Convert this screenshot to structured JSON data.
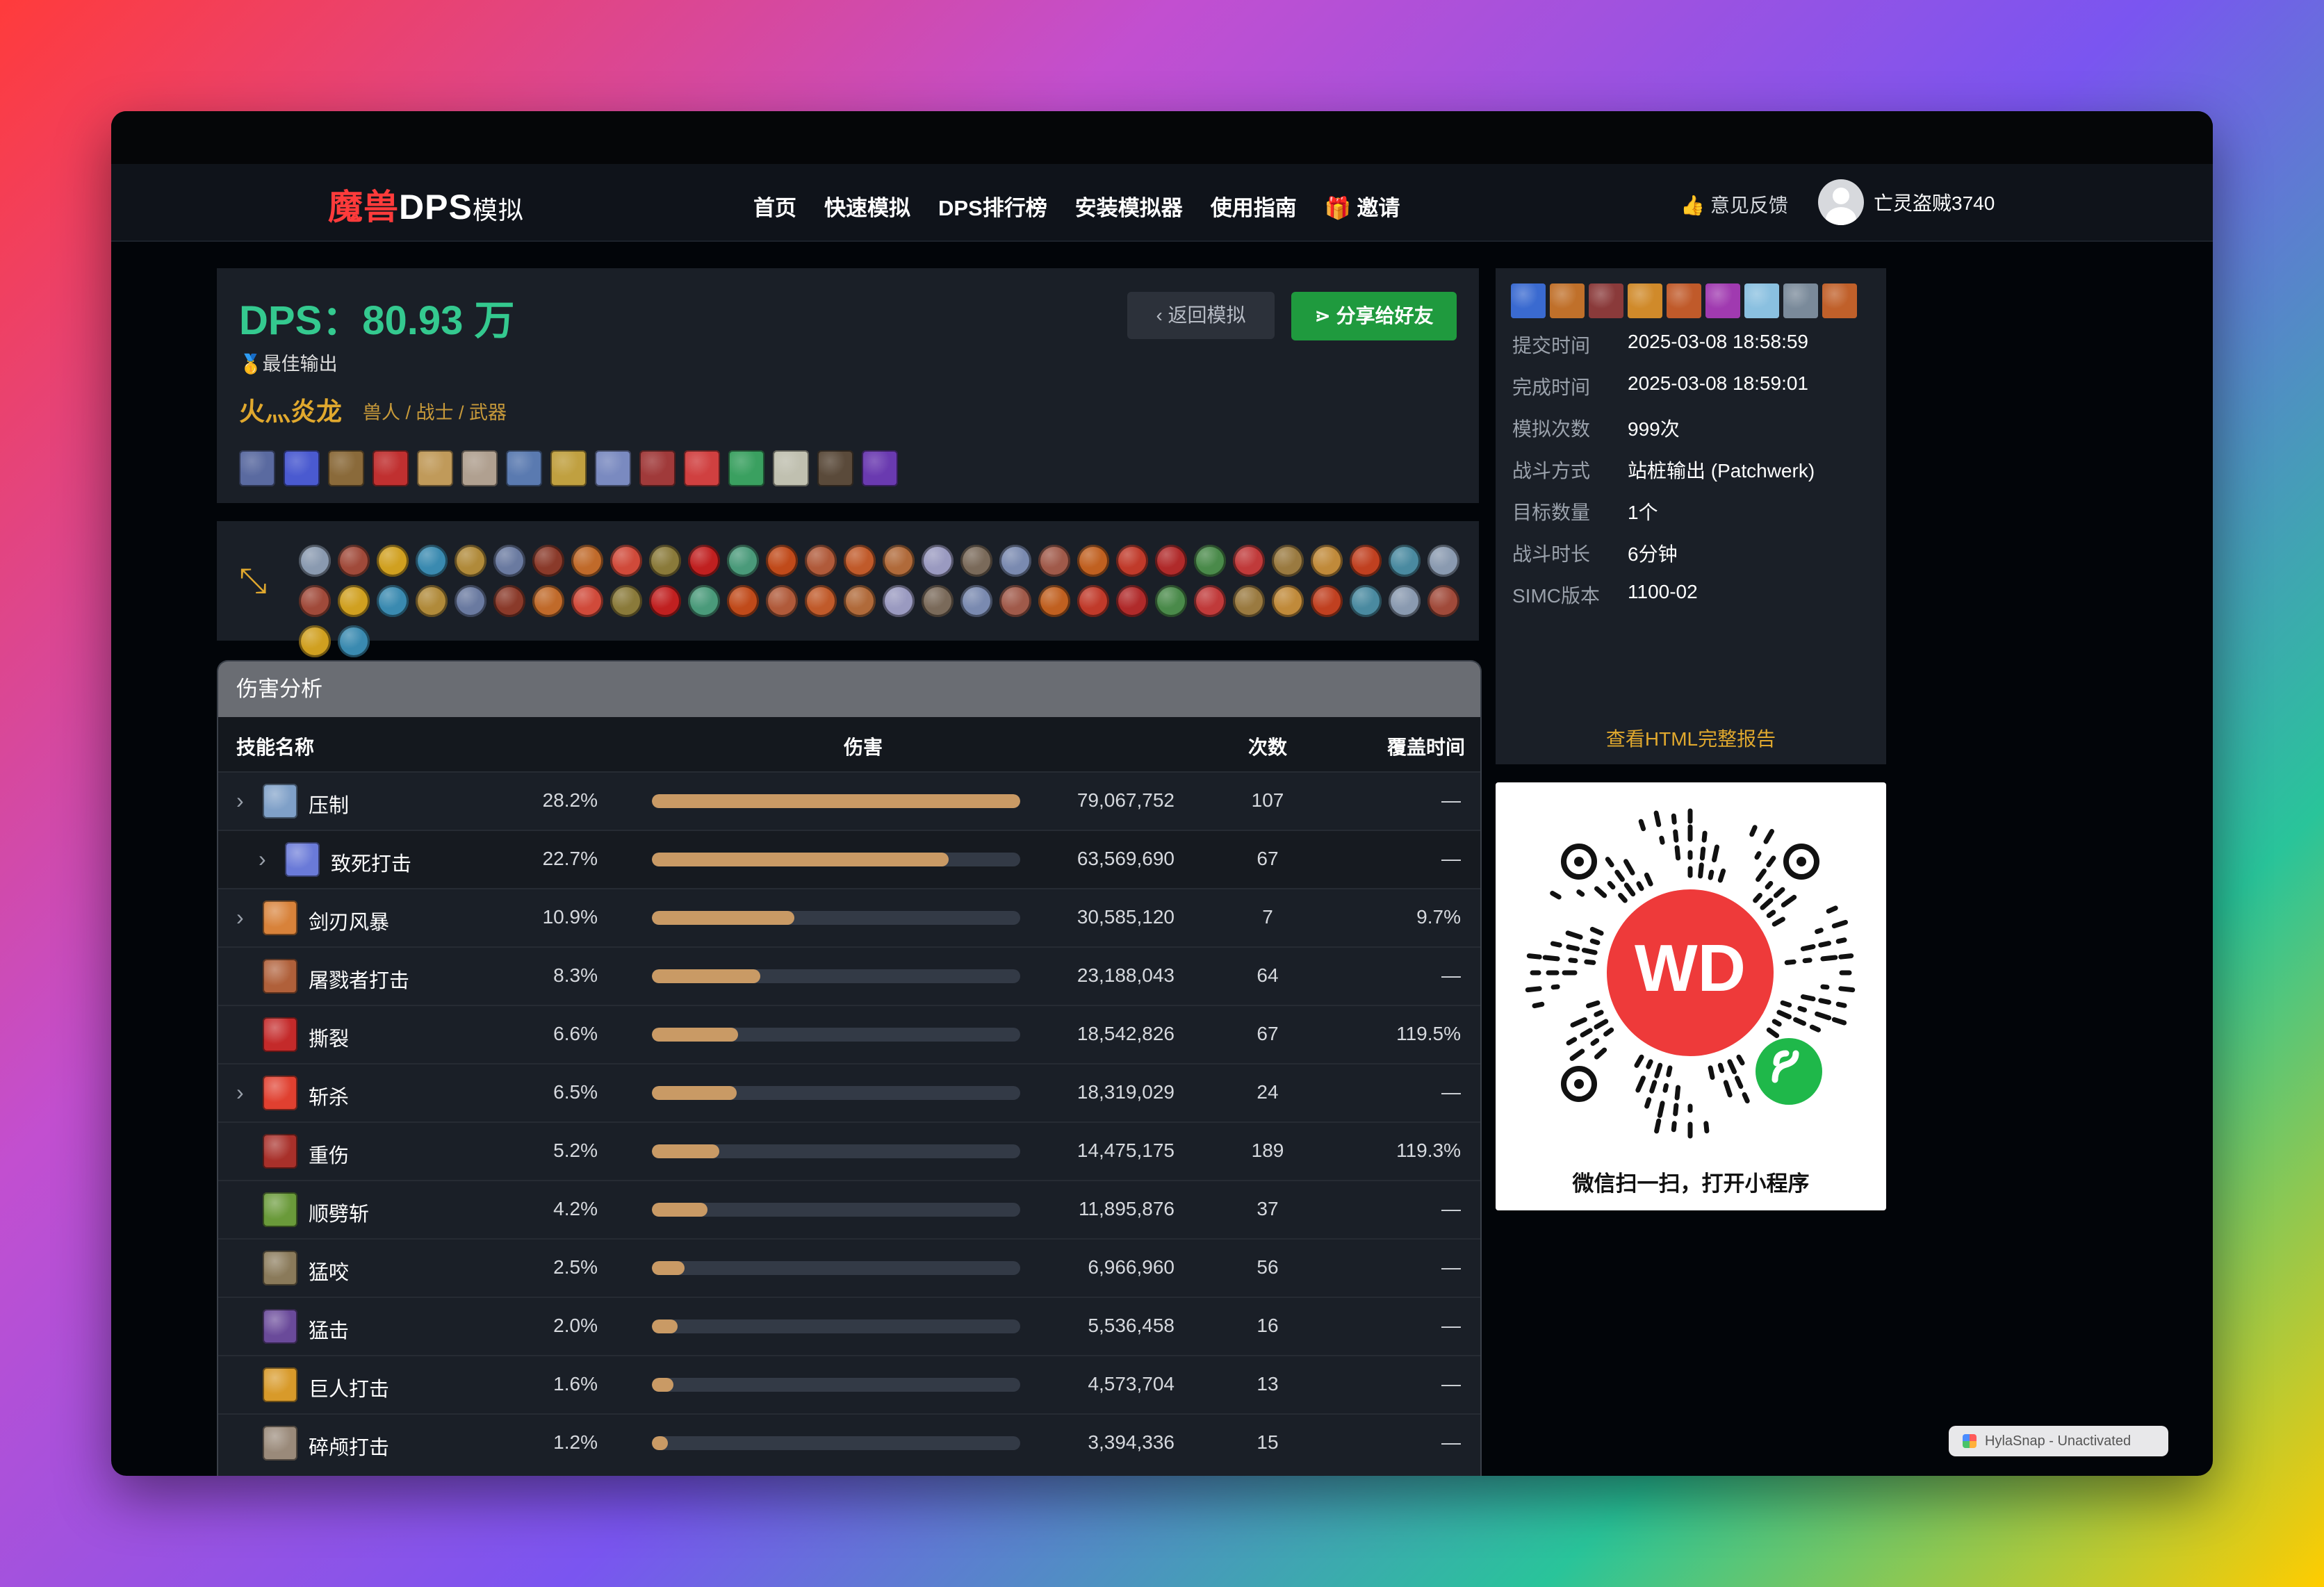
{
  "navbar": {
    "logo_red": "魔兽",
    "logo_white": "DPS",
    "logo_small": "模拟",
    "items": [
      {
        "label": "首页"
      },
      {
        "label": "快速模拟"
      },
      {
        "label": "DPS排行榜"
      },
      {
        "label": "安装模拟器"
      },
      {
        "label": "使用指南"
      },
      {
        "label": "邀请",
        "icon": "gift-icon"
      }
    ],
    "feedback": "意见反馈",
    "username": "亡灵盗贼3740"
  },
  "hero": {
    "dps": "DPS：80.93 万",
    "badge": "🥇最佳输出",
    "character_name": "火灬炎龙",
    "character_meta": "兽人 / 战士 / 武器",
    "back_button": "返回模拟",
    "share_button": "分享给好友",
    "gear_slots": 15
  },
  "talents": {
    "count": 62
  },
  "sim_info": [
    {
      "key": "提交时间",
      "value": "2025-03-08 18:58:59"
    },
    {
      "key": "完成时间",
      "value": "2025-03-08 18:59:01"
    },
    {
      "key": "模拟次数",
      "value": "999次"
    },
    {
      "key": "战斗方式",
      "value": "站桩输出 (Patchwerk)"
    },
    {
      "key": "目标数量",
      "value": "1个"
    },
    {
      "key": "战斗时长",
      "value": "6分钟"
    },
    {
      "key": "SIMC版本",
      "value": "1100-02"
    }
  ],
  "html_report_link": "查看HTML完整报告",
  "qr": {
    "logo_text": "WD",
    "caption": "微信扫一扫，打开小程序"
  },
  "damage": {
    "title": "伤害分析",
    "columns": {
      "name": "技能名称",
      "damage": "伤害",
      "count": "次数",
      "coverage": "覆盖时间"
    },
    "rows": [
      {
        "name": "压制",
        "pct": "28.2%",
        "share": 1.0,
        "damage": "79,067,752",
        "count": "107",
        "coverage": "—",
        "expandable": true,
        "sub": false,
        "color": "#7fa0c8"
      },
      {
        "name": "致死打击",
        "pct": "22.7%",
        "share": 0.805,
        "damage": "63,569,690",
        "count": "67",
        "coverage": "—",
        "expandable": true,
        "sub": true,
        "color": "#6a7ad8"
      },
      {
        "name": "剑刃风暴",
        "pct": "10.9%",
        "share": 0.387,
        "damage": "30,585,120",
        "count": "7",
        "coverage": "9.7%",
        "expandable": true,
        "sub": false,
        "color": "#d8823a"
      },
      {
        "name": "屠戮者打击",
        "pct": "8.3%",
        "share": 0.294,
        "damage": "23,188,043",
        "count": "64",
        "coverage": "—",
        "expandable": false,
        "sub": false,
        "color": "#b0603a"
      },
      {
        "name": "撕裂",
        "pct": "6.6%",
        "share": 0.234,
        "damage": "18,542,826",
        "count": "67",
        "coverage": "119.5%",
        "expandable": false,
        "sub": false,
        "color": "#c42a2a"
      },
      {
        "name": "斩杀",
        "pct": "6.5%",
        "share": 0.231,
        "damage": "18,319,029",
        "count": "24",
        "coverage": "—",
        "expandable": true,
        "sub": false,
        "color": "#e04030"
      },
      {
        "name": "重伤",
        "pct": "5.2%",
        "share": 0.183,
        "damage": "14,475,175",
        "count": "189",
        "coverage": "119.3%",
        "expandable": false,
        "sub": false,
        "color": "#a8302a"
      },
      {
        "name": "顺劈斩",
        "pct": "4.2%",
        "share": 0.15,
        "damage": "11,895,876",
        "count": "37",
        "coverage": "—",
        "expandable": false,
        "sub": false,
        "color": "#6a9a3a"
      },
      {
        "name": "猛咬",
        "pct": "2.5%",
        "share": 0.088,
        "damage": "6,966,960",
        "count": "56",
        "coverage": "—",
        "expandable": false,
        "sub": false,
        "color": "#8a7a5a"
      },
      {
        "name": "猛击",
        "pct": "2.0%",
        "share": 0.07,
        "damage": "5,536,458",
        "count": "16",
        "coverage": "—",
        "expandable": false,
        "sub": false,
        "color": "#6a4a9a"
      },
      {
        "name": "巨人打击",
        "pct": "1.6%",
        "share": 0.058,
        "damage": "4,573,704",
        "count": "13",
        "coverage": "—",
        "expandable": false,
        "sub": false,
        "color": "#d89a2a"
      },
      {
        "name": "碎颅打击",
        "pct": "1.2%",
        "share": 0.043,
        "damage": "3,394,336",
        "count": "15",
        "coverage": "—",
        "expandable": false,
        "sub": false,
        "color": "#9a8a7a"
      }
    ]
  },
  "watermark": "HylaSnap - Unactivated",
  "colors": {
    "accent_green": "#34c98f",
    "gold": "#e0a82e",
    "bar": "#c99a65",
    "share_button": "#1f9a3e"
  }
}
